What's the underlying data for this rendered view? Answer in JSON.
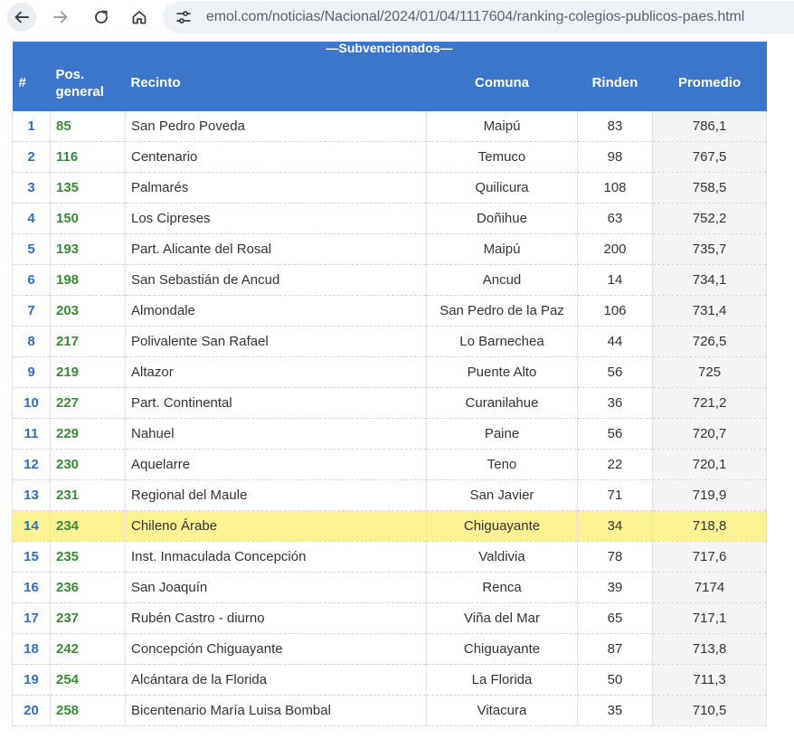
{
  "browser": {
    "url": "emol.com/noticias/Nacional/2024/01/04/1117604/ranking-colegios-publicos-paes.html",
    "icons": [
      "back-arrow-icon",
      "forward-arrow-icon",
      "reload-icon",
      "home-icon",
      "site-info-icon"
    ]
  },
  "table": {
    "caption": "—Subvencionados—",
    "headers": {
      "num": "#",
      "pos_line1": "Pos.",
      "pos_line2": "general",
      "recinto": "Recinto",
      "comuna": "Comuna",
      "rinden": "Rinden",
      "promedio": "Promedio"
    },
    "highlight_color": "#fbf391",
    "header_color": "#3b78cc",
    "rows": [
      {
        "num": "1",
        "pos": "85",
        "recinto": "San Pedro Poveda",
        "comuna": "Maipú",
        "rinden": "83",
        "promedio": "786,1"
      },
      {
        "num": "2",
        "pos": "116",
        "recinto": "Centenario",
        "comuna": "Temuco",
        "rinden": "98",
        "promedio": "767,5"
      },
      {
        "num": "3",
        "pos": "135",
        "recinto": "Palmarés",
        "comuna": "Quilicura",
        "rinden": "108",
        "promedio": "758,5"
      },
      {
        "num": "4",
        "pos": "150",
        "recinto": "Los Cipreses",
        "comuna": "Doñihue",
        "rinden": "63",
        "promedio": "752,2"
      },
      {
        "num": "5",
        "pos": "193",
        "recinto": "Part. Alicante del Rosal",
        "comuna": "Maipú",
        "rinden": "200",
        "promedio": "735,7"
      },
      {
        "num": "6",
        "pos": "198",
        "recinto": "San Sebastián de Ancud",
        "comuna": "Ancud",
        "rinden": "14",
        "promedio": "734,1"
      },
      {
        "num": "7",
        "pos": "203",
        "recinto": "Almondale",
        "comuna": "San Pedro de la Paz",
        "rinden": "106",
        "promedio": "731,4"
      },
      {
        "num": "8",
        "pos": "217",
        "recinto": "Polivalente San Rafael",
        "comuna": "Lo Barnechea",
        "rinden": "44",
        "promedio": "726,5"
      },
      {
        "num": "9",
        "pos": "219",
        "recinto": "Altazor",
        "comuna": "Puente Alto",
        "rinden": "56",
        "promedio": "725"
      },
      {
        "num": "10",
        "pos": "227",
        "recinto": "Part. Continental",
        "comuna": "Curanilahue",
        "rinden": "36",
        "promedio": "721,2"
      },
      {
        "num": "11",
        "pos": "229",
        "recinto": "Nahuel",
        "comuna": "Paine",
        "rinden": "56",
        "promedio": "720,7"
      },
      {
        "num": "12",
        "pos": "230",
        "recinto": "Aquelarre",
        "comuna": "Teno",
        "rinden": "22",
        "promedio": "720,1"
      },
      {
        "num": "13",
        "pos": "231",
        "recinto": "Regional del Maule",
        "comuna": "San Javier",
        "rinden": "71",
        "promedio": "719,9"
      },
      {
        "num": "14",
        "pos": "234",
        "recinto": "Chileno Árabe",
        "comuna": "Chiguayante",
        "rinden": "34",
        "promedio": "718,8",
        "highlighted": true
      },
      {
        "num": "15",
        "pos": "235",
        "recinto": "Inst. Inmaculada Concepción",
        "comuna": "Valdivia",
        "rinden": "78",
        "promedio": "717,6"
      },
      {
        "num": "16",
        "pos": "236",
        "recinto": "San Joaquín",
        "comuna": "Renca",
        "rinden": "39",
        "promedio": "7174"
      },
      {
        "num": "17",
        "pos": "237",
        "recinto": "Rubén Castro - diurno",
        "comuna": "Viña del Mar",
        "rinden": "65",
        "promedio": "717,1"
      },
      {
        "num": "18",
        "pos": "242",
        "recinto": "Concepción Chiguayante",
        "comuna": "Chiguayante",
        "rinden": "87",
        "promedio": "713,8"
      },
      {
        "num": "19",
        "pos": "254",
        "recinto": "Alcántara de la Florida",
        "comuna": "La Florida",
        "rinden": "50",
        "promedio": "711,3"
      },
      {
        "num": "20",
        "pos": "258",
        "recinto": "Bicentenario María Luisa Bombal",
        "comuna": "Vitacura",
        "rinden": "35",
        "promedio": "710,5"
      }
    ]
  }
}
